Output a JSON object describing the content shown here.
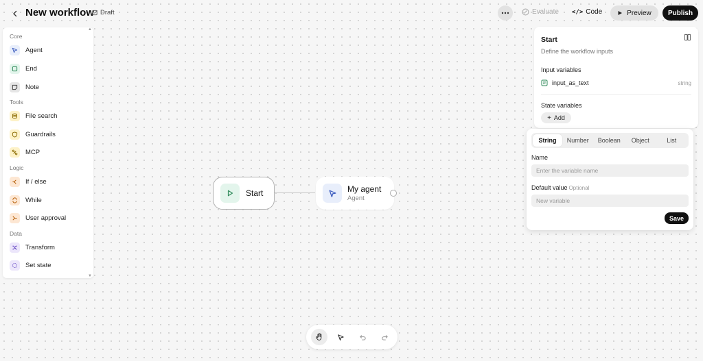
{
  "header": {
    "title": "New workflow",
    "draft_label": "Draft",
    "evaluate_label": "Evaluate",
    "code_label": "Code",
    "preview_label": "Preview",
    "publish_label": "Publish"
  },
  "sidebar": {
    "sections": [
      {
        "title": "Core",
        "items": [
          {
            "label": "Agent",
            "icon": "agent-cursor-icon",
            "color": "#e8eefb"
          },
          {
            "label": "End",
            "icon": "end-square-icon",
            "color": "#e3f5ec"
          },
          {
            "label": "Note",
            "icon": "note-icon",
            "color": "#e6e6e6"
          }
        ]
      },
      {
        "title": "Tools",
        "items": [
          {
            "label": "File search",
            "icon": "database-icon",
            "color": "#fdf2c8"
          },
          {
            "label": "Guardrails",
            "icon": "shield-icon",
            "color": "#fdf2c8"
          },
          {
            "label": "MCP",
            "icon": "mcp-icon",
            "color": "#fdf2c8"
          }
        ]
      },
      {
        "title": "Logic",
        "items": [
          {
            "label": "If / else",
            "icon": "branch-icon",
            "color": "#fde7d3"
          },
          {
            "label": "While",
            "icon": "loop-icon",
            "color": "#fde7d3"
          },
          {
            "label": "User approval",
            "icon": "approval-icon",
            "color": "#fde7d3"
          }
        ]
      },
      {
        "title": "Data",
        "items": [
          {
            "label": "Transform",
            "icon": "shuffle-icon",
            "color": "#ece6fb"
          },
          {
            "label": "Set state",
            "icon": "set-state-icon",
            "color": "#ece6fb"
          }
        ]
      }
    ]
  },
  "canvas": {
    "start_node": {
      "title": "Start",
      "icon": "play-icon",
      "color": "#e3f5ec"
    },
    "agent_node": {
      "title": "My agent",
      "subtitle": "Agent",
      "icon": "agent-cursor-icon",
      "color": "#e8eefb"
    }
  },
  "properties": {
    "title": "Start",
    "description": "Define the workflow inputs",
    "input_variables_label": "Input variables",
    "input_variable": {
      "name": "input_as_text",
      "type": "string"
    },
    "state_variables_label": "State variables",
    "add_label": "Add"
  },
  "variable_form": {
    "tabs": [
      "String",
      "Number",
      "Boolean",
      "Object",
      "List"
    ],
    "active_tab": "String",
    "name_label": "Name",
    "name_placeholder": "Enter the variable name",
    "default_label": "Default value",
    "optional_label": "Optional",
    "default_placeholder": "New variable",
    "save_label": "Save"
  },
  "toolbar": {
    "tools": [
      "hand-icon",
      "pointer-icon",
      "undo-icon",
      "redo-icon"
    ],
    "active_tool": "hand-icon"
  }
}
